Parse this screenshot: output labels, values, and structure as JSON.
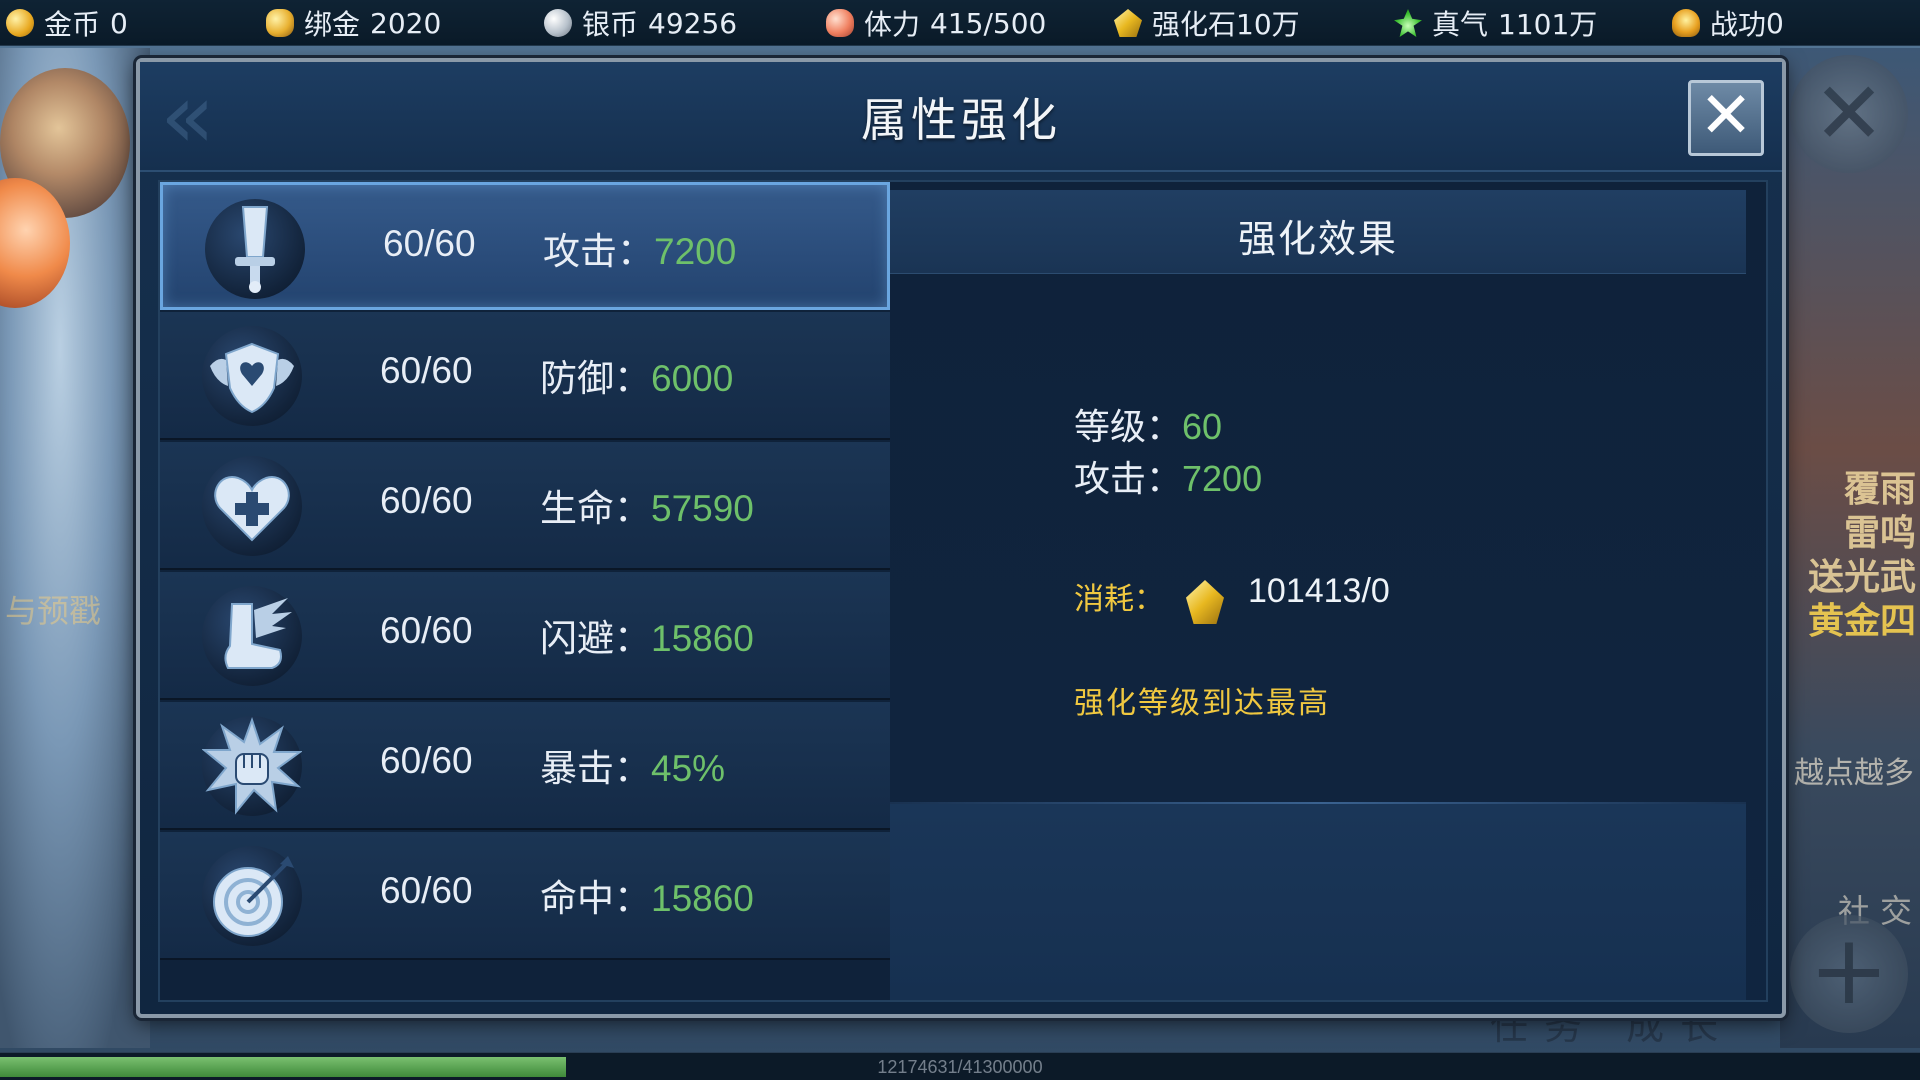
{
  "resources": [
    {
      "icon": "gold-coin-icon",
      "label": "金币",
      "value": "0"
    },
    {
      "icon": "bound-gold-icon",
      "label": "绑金",
      "value": "2020"
    },
    {
      "icon": "silver-coin-icon",
      "label": "银币",
      "value": "49256"
    },
    {
      "icon": "stamina-icon",
      "label": "体力",
      "value": "415/500"
    },
    {
      "icon": "enhance-stone-icon",
      "label": "强化石",
      "value": "10万"
    },
    {
      "icon": "true-qi-icon",
      "label": "真气",
      "value": "1101万"
    },
    {
      "icon": "merit-icon",
      "label": "战功",
      "value": "0"
    }
  ],
  "dialog": {
    "title": "属性强化",
    "close_label": "✕"
  },
  "attributes": [
    {
      "icon": "sword-icon",
      "level": "60/60",
      "name": "攻击",
      "sep": "：",
      "value": "7200",
      "selected": true
    },
    {
      "icon": "shield-icon",
      "level": "60/60",
      "name": "防御",
      "sep": "：",
      "value": "6000",
      "selected": false
    },
    {
      "icon": "heart-cross-icon",
      "level": "60/60",
      "name": "生命",
      "sep": "：",
      "value": "57590",
      "selected": false
    },
    {
      "icon": "winged-boot-icon",
      "level": "60/60",
      "name": "闪避",
      "sep": "：",
      "value": "15860",
      "selected": false
    },
    {
      "icon": "burst-fist-icon",
      "level": "60/60",
      "name": "暴击",
      "sep": "：",
      "value": "45%",
      "selected": false
    },
    {
      "icon": "target-arrow-icon",
      "level": "60/60",
      "name": "命中",
      "sep": "：",
      "value": "15860",
      "selected": false
    }
  ],
  "effect": {
    "title": "强化效果",
    "level_label": "等级：",
    "level_value": "60",
    "stat_label": "攻击：",
    "stat_value": "7200",
    "cost_label": "消耗：",
    "cost_icon": "enhance-stone-icon",
    "cost_value": "101413/0",
    "max_message": "强化等级到达最高"
  },
  "background": {
    "left_label": "与预戳",
    "right_promo": [
      "覆雨",
      "雷鸣",
      "送光武",
      "黄金四"
    ],
    "right_sub": "越点越多",
    "right_social": "社 交",
    "bottom_tabs": "任务 成长"
  },
  "exp": {
    "text": "12174631/41300000",
    "progress": 0.295
  },
  "colors": {
    "value_green": "#6ec06a",
    "highlight_gold": "#f0c840",
    "selected_border": "#6aa6e0"
  }
}
